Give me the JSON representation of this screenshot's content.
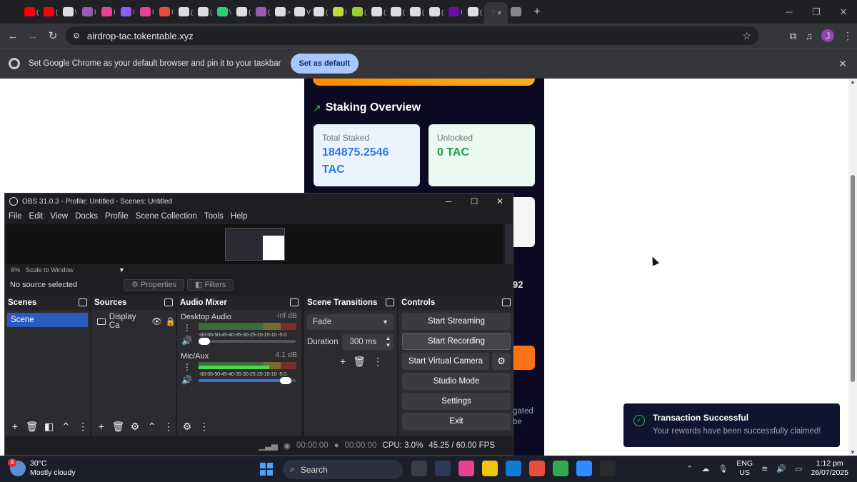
{
  "browser": {
    "tabs": [
      {
        "icon": "youtube-icon",
        "color": "#ff0000",
        "frag": "("
      },
      {
        "icon": "youtube-icon",
        "color": "#ff0000",
        "frag": "("
      },
      {
        "icon": "list-icon",
        "color": "#dddddd",
        "frag": "\\"
      },
      {
        "icon": "app-icon",
        "color": "#9b59b6",
        "frag": "I"
      },
      {
        "icon": "m-icon",
        "color": "#e84393",
        "frag": "I"
      },
      {
        "icon": "p-icon",
        "color": "#8e5cff",
        "frag": "I"
      },
      {
        "icon": "m-icon",
        "color": "#e84393",
        "frag": "I"
      },
      {
        "icon": "cup-icon",
        "color": "#e74c3c",
        "frag": "I"
      },
      {
        "icon": "x-icon",
        "color": "#dddddd",
        "frag": "("
      },
      {
        "icon": "x-icon",
        "color": "#dddddd",
        "frag": "("
      },
      {
        "icon": "circle-icon",
        "color": "#2ecc71",
        "frag": "\\"
      },
      {
        "icon": "x-icon",
        "color": "#dddddd",
        "frag": "("
      },
      {
        "icon": "bolt-icon",
        "color": "#9b59b6",
        "frag": "("
      },
      {
        "icon": "x-icon",
        "color": "#dddddd",
        "frag": ">"
      },
      {
        "icon": "speaker-icon",
        "color": "#dddddd",
        "frag": "V"
      },
      {
        "icon": "x-icon",
        "color": "#dddddd",
        "frag": "("
      },
      {
        "icon": "smile-icon",
        "color": "#c0d93b",
        "frag": "I"
      },
      {
        "icon": "gear-icon",
        "color": "#9acd32",
        "frag": "("
      },
      {
        "icon": "x-icon",
        "color": "#dddddd",
        "frag": "("
      },
      {
        "icon": "x-icon",
        "color": "#dddddd",
        "frag": "("
      },
      {
        "icon": "x-icon",
        "color": "#dddddd",
        "frag": "("
      },
      {
        "icon": "list-icon",
        "color": "#dddddd",
        "frag": "("
      },
      {
        "icon": "w-icon",
        "color": "#6a0dad",
        "frag": "I"
      },
      {
        "icon": "face-icon",
        "color": "#dddddd",
        "frag": "("
      }
    ],
    "active_tab": {
      "frag": "'",
      "close": "✕"
    },
    "url": "airdrop-tac.tokentable.xyz",
    "avatar_letter": "J",
    "infobar_message": "Set Google Chrome as your default browser and pin it to your taskbar",
    "infobar_button": "Set as default"
  },
  "dapp": {
    "section_title": "Staking Overview",
    "total_staked_label": "Total Staked",
    "total_staked_value": "184875.2546 TAC",
    "unlocked_label": "Unlocked",
    "unlocked_value": "0 TAC",
    "partial_value": "92",
    "partial_text_1": "gated",
    "partial_text_2": "be"
  },
  "toast": {
    "title": "Transaction Successful",
    "message": "Your rewards have been successfully claimed!"
  },
  "obs": {
    "title": "OBS 31.0.3 - Profile: Untitled - Scenes: Untitled",
    "menu": [
      "File",
      "Edit",
      "View",
      "Docks",
      "Profile",
      "Scene Collection",
      "Tools",
      "Help"
    ],
    "zoom": "6%",
    "scale_mode": "Scale to Window",
    "no_source": "No source selected",
    "properties": "Properties",
    "filters": "Filters",
    "docks": {
      "scenes": "Scenes",
      "sources": "Sources",
      "audio_mixer": "Audio Mixer",
      "scene_transitions": "Scene Transitions",
      "controls": "Controls"
    },
    "scene_item": "Scene",
    "source_item": "Display Ca",
    "audio": [
      {
        "name": "Desktop Audio",
        "db": "-inf dB",
        "level": 0.0,
        "volume": 0.0
      },
      {
        "name": "Mic/Aux",
        "db": "4.1 dB",
        "level": 0.72,
        "volume": 0.95
      }
    ],
    "meter_ticks": "-60-55-50-45-40-35-30-25-20-15-10 -5  0",
    "transition": "Fade",
    "duration_label": "Duration",
    "duration_value": "300 ms",
    "controls": {
      "start_streaming": "Start Streaming",
      "start_recording": "Start Recording",
      "start_virtual_camera": "Start Virtual Camera",
      "studio_mode": "Studio Mode",
      "settings": "Settings",
      "exit": "Exit"
    },
    "status": {
      "stream_time": "00:00:00",
      "record_time": "00:00:00",
      "cpu": "CPU: 3.0%",
      "fps": "45.25 / 60.00 FPS"
    }
  },
  "taskbar": {
    "weather_badge": "8",
    "temperature": "30°C",
    "condition": "Mostly cloudy",
    "search": "Search",
    "lang_1": "ENG",
    "lang_2": "US",
    "time": "1:12 pm",
    "date": "26/07/2025",
    "app_colors": [
      "#3a3d4a",
      "#2b3a55",
      "#e84393",
      "#f1c40f",
      "#0f7bd6",
      "#e74c3c",
      "#34a853",
      "#2d8cff",
      "#2b2b2b"
    ]
  }
}
